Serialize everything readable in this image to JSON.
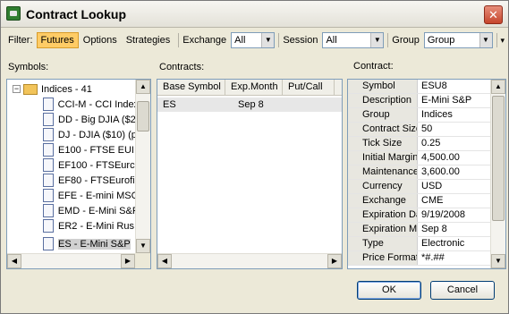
{
  "window": {
    "title": "Contract Lookup"
  },
  "filterbar": {
    "filter_label": "Filter:",
    "types": [
      "Futures",
      "Options",
      "Strategies"
    ],
    "exchange_label": "Exchange",
    "exchange_value": "All",
    "session_label": "Session",
    "session_value": "All",
    "group_label": "Group",
    "group_value": "Group"
  },
  "symbols": {
    "label": "Symbols:",
    "root": "Indices - 41",
    "items": [
      "CCI-M - CCI Index",
      "DD - Big DJIA ($2",
      "DJ - DJIA ($10) (p",
      "E100 - FTSE EUI",
      "EF100 - FTSEurc",
      "EF80 - FTSEurofi",
      "EFE - E-mini MSC",
      "EMD - E-Mini S&F",
      "ER2 - E-Mini Rus",
      "ES - E-Mini S&P"
    ]
  },
  "contracts": {
    "label": "Contracts:",
    "columns": [
      "Base Symbol",
      "Exp.Month",
      "Put/Call"
    ],
    "rows": [
      {
        "base": "ES",
        "month": "Sep 8",
        "putcall": ""
      }
    ]
  },
  "contract": {
    "label": "Contract:",
    "props": [
      {
        "key": "Symbol",
        "value": "ESU8"
      },
      {
        "key": "Description",
        "value": "E-Mini S&P"
      },
      {
        "key": "Group",
        "value": "Indices"
      },
      {
        "key": "Contract Size",
        "value": "50"
      },
      {
        "key": "Tick Size",
        "value": "0.25"
      },
      {
        "key": "Initial Margin",
        "value": "4,500.00"
      },
      {
        "key": "Maintenance",
        "value": "3,600.00"
      },
      {
        "key": "Currency",
        "value": "USD"
      },
      {
        "key": "Exchange",
        "value": "CME"
      },
      {
        "key": "Expiration Da",
        "value": "9/19/2008"
      },
      {
        "key": "Expiration Mo",
        "value": "Sep 8"
      },
      {
        "key": "Type",
        "value": "Electronic"
      },
      {
        "key": "Price Format",
        "value": "*#.##"
      }
    ]
  },
  "buttons": {
    "ok": "OK",
    "cancel": "Cancel"
  }
}
